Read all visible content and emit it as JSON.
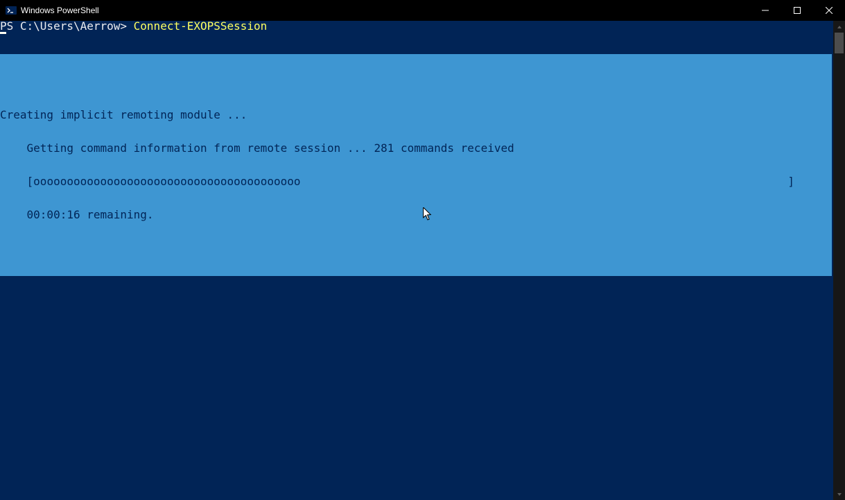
{
  "window": {
    "title": "Windows PowerShell"
  },
  "console": {
    "prompt_prefix": "PS C:\\Users\\Aerrow> ",
    "command": "Connect-EXOPSSession"
  },
  "progress": {
    "title": "Creating implicit remoting module ...",
    "status": "    Getting command information from remote session ... 281 commands received",
    "bar_open": "    [",
    "bar_fill": "oooooooooooooooooooooooooooooooooooooooo",
    "bar_close": "]",
    "remaining": "    00:00:16 remaining."
  },
  "controls": {
    "minimize": "minimize",
    "maximize": "maximize",
    "close": "close"
  }
}
